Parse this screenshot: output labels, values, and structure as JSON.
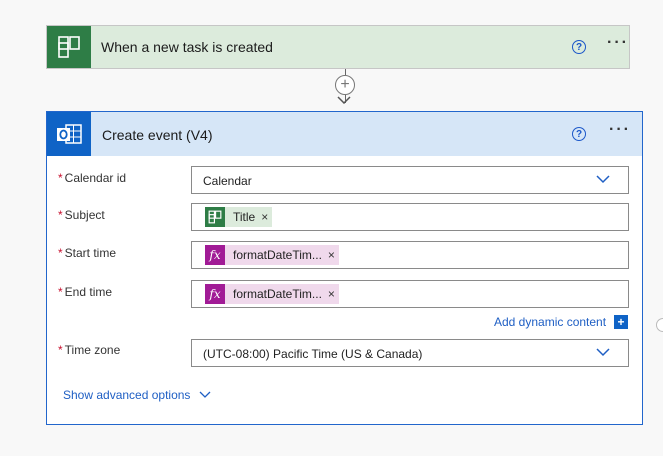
{
  "trigger": {
    "title": "When a new task is created",
    "icon": "planner-icon",
    "help": "?",
    "more": "···"
  },
  "connector": {
    "plus": "+"
  },
  "action": {
    "title": "Create event (V4)",
    "icon": "outlook-icon",
    "help": "?",
    "more": "···",
    "required_mark": "*",
    "fields": {
      "calendar_id": {
        "label": "Calendar id",
        "value": "Calendar"
      },
      "subject": {
        "label": "Subject",
        "token": "Title",
        "remove": "×"
      },
      "start_time": {
        "label": "Start time",
        "token_icon": "fx",
        "token": "formatDateTim...",
        "remove": "×"
      },
      "end_time": {
        "label": "End time",
        "token_icon": "fx",
        "token": "formatDateTim...",
        "remove": "×"
      },
      "time_zone": {
        "label": "Time zone",
        "value": "(UTC-08:00) Pacific Time (US & Canada)"
      }
    },
    "add_dynamic_content": "Add dynamic content",
    "add_dynamic_plus": "+",
    "show_advanced": "Show advanced options"
  },
  "colors": {
    "accent": "#1f5fc4",
    "planner_green": "#2e7d46",
    "outlook_blue": "#0f63c6",
    "expression_purple": "#a11b96",
    "required_red": "#c8102e"
  }
}
